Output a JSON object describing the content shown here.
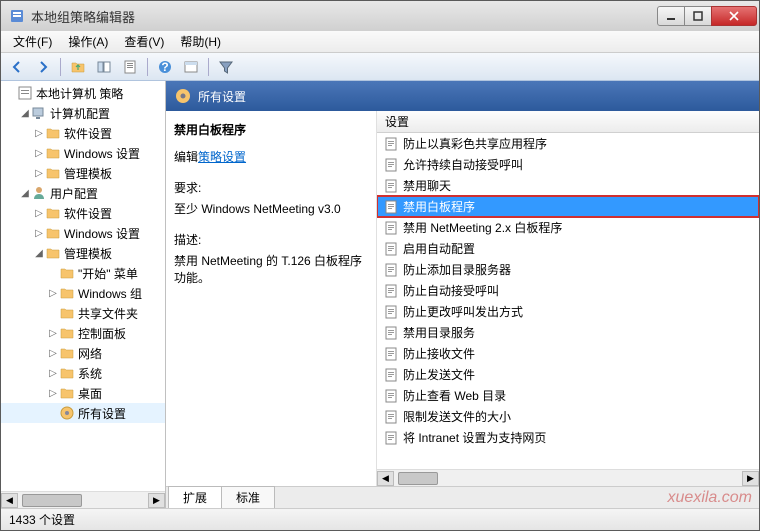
{
  "window": {
    "title": "本地组策略编辑器"
  },
  "menu": {
    "file": "文件(F)",
    "action": "操作(A)",
    "view": "查看(V)",
    "help": "帮助(H)"
  },
  "tree": {
    "root": "本地计算机 策略",
    "computer_config": "计算机配置",
    "software_settings": "软件设置",
    "windows_settings": "Windows 设置",
    "admin_templates": "管理模板",
    "user_config": "用户配置",
    "start_menu": "\"开始\" 菜单",
    "windows_components": "Windows 组",
    "shared_folders": "共享文件夹",
    "control_panel": "控制面板",
    "network": "网络",
    "system": "系统",
    "desktop": "桌面",
    "all_settings": "所有设置"
  },
  "header": {
    "title": "所有设置"
  },
  "detail": {
    "title": "禁用白板程序",
    "edit_prefix": "编辑",
    "edit_link": "策略设置",
    "req_label": "要求:",
    "req_value": "至少 Windows NetMeeting v3.0",
    "desc_label": "描述:",
    "desc_value": "禁用 NetMeeting 的 T.126 白板程序功能。"
  },
  "list": {
    "column": "设置",
    "items": [
      "防止以真彩色共享应用程序",
      "允许持续自动接受呼叫",
      "禁用聊天",
      "禁用白板程序",
      "禁用 NetMeeting 2.x 白板程序",
      "启用自动配置",
      "防止添加目录服务器",
      "防止自动接受呼叫",
      "防止更改呼叫发出方式",
      "禁用目录服务",
      "防止接收文件",
      "防止发送文件",
      "防止查看 Web 目录",
      "限制发送文件的大小",
      "将 Intranet 设置为支持网页"
    ],
    "selected_index": 3
  },
  "tabs": {
    "extended": "扩展",
    "standard": "标准"
  },
  "status": {
    "text": "1433 个设置"
  },
  "watermark": "xuexila.com"
}
